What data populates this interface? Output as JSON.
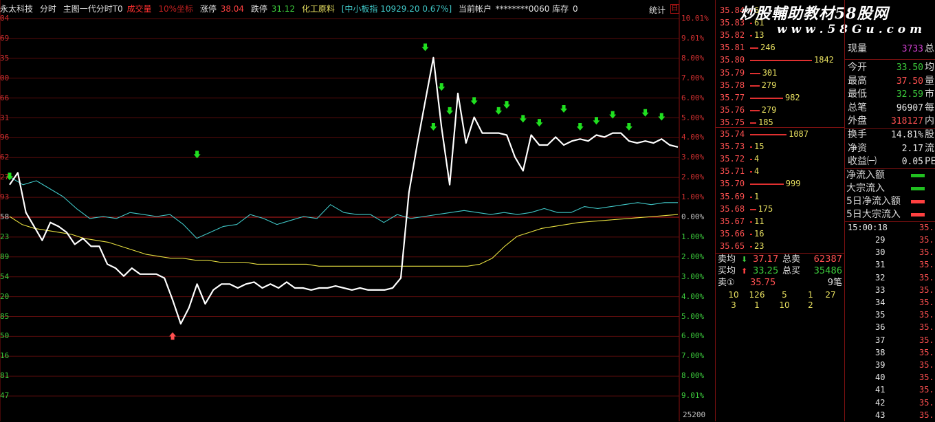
{
  "topbar": {
    "stock_name": "永太科技",
    "chart_mode": "分时",
    "indicator": "主图一代分时T0",
    "volume_label": "成交量",
    "sector_label": "10%坐标",
    "limit_up_label": "涨停",
    "limit_up_value": "38.04",
    "limit_down_label": "跌停",
    "limit_down_value": "31.12",
    "industry": "化工原料",
    "index_text": "[中小板指 10929.20 0.67%]",
    "account_label": "当前帐户",
    "account_value": "********0060",
    "inventory_label": "库存",
    "inventory_value": "0",
    "stats_button": "统计",
    "stats_box": "日"
  },
  "watermark": {
    "title": "炒股輔助教材58股网",
    "url": "w w w . 5 8 G u . c o m"
  },
  "left_axis": [
    "04",
    "69",
    "35",
    "00",
    "66",
    "31",
    "96",
    "62",
    "27",
    "93",
    "58",
    "23",
    "89",
    "54",
    "20",
    "85",
    "50",
    "16",
    "81",
    "47"
  ],
  "right_axis": [
    "10.01%",
    "9.01%",
    "8.00%",
    "7.00%",
    "6.00%",
    "5.00%",
    "4.00%",
    "3.00%",
    "2.00%",
    "1.00%",
    "0.00%",
    "1.00%",
    "2.00%",
    "3.00%",
    "4.00%",
    "5.00%",
    "6.00%",
    "7.00%",
    "8.00%",
    "9.01%"
  ],
  "volume_axis_label": "25200",
  "chart_data": {
    "type": "line",
    "title": "",
    "series": [
      {
        "name": "price",
        "color": "#ffffff",
        "values": [
          1.6,
          2.2,
          0.2,
          -0.5,
          -1.2,
          -0.3,
          -0.5,
          -0.8,
          -1.4,
          -1.1,
          -1.5,
          -1.5,
          -2.4,
          -2.6,
          -3.0,
          -2.6,
          -2.9,
          -2.9,
          -2.9,
          -3.1,
          -4.2,
          -5.4,
          -4.6,
          -3.4,
          -4.4,
          -3.7,
          -3.4,
          -3.4,
          -3.6,
          -3.4,
          -3.3,
          -3.6,
          -3.4,
          -3.6,
          -3.3,
          -3.6,
          -3.6,
          -3.7,
          -3.6,
          -3.6,
          -3.5,
          -3.6,
          -3.7,
          -3.6,
          -3.7,
          -3.7,
          -3.7,
          -3.6,
          -3.1,
          1.2,
          3.6,
          5.8,
          8.0,
          4.5,
          1.6,
          6.2,
          3.7,
          5.0,
          4.2,
          4.2,
          4.2,
          4.1,
          3.0,
          2.3,
          4.1,
          3.6,
          3.6,
          4.0,
          3.6,
          3.8,
          3.9,
          3.8,
          4.1,
          4.0,
          4.2,
          4.2,
          3.8,
          3.7,
          3.8,
          3.7,
          3.9,
          3.6,
          3.5
        ]
      },
      {
        "name": "average",
        "color": "#e8e040",
        "values": [
          0.0,
          -0.4,
          -0.6,
          -0.7,
          -0.8,
          -0.9,
          -1.1,
          -1.2,
          -1.3,
          -1.5,
          -1.7,
          -1.9,
          -2.0,
          -2.1,
          -2.1,
          -2.2,
          -2.2,
          -2.3,
          -2.3,
          -2.3,
          -2.4,
          -2.4,
          -2.4,
          -2.4,
          -2.4,
          -2.5,
          -2.5,
          -2.5,
          -2.5,
          -2.5,
          -2.5,
          -2.5,
          -2.5,
          -2.5,
          -2.5,
          -2.5,
          -2.5,
          -2.5,
          -2.4,
          -2.1,
          -1.5,
          -1.0,
          -0.8,
          -0.6,
          -0.5,
          -0.4,
          -0.3,
          -0.25,
          -0.2,
          -0.15,
          -0.1,
          -0.05,
          0.0,
          0.05,
          0.1
        ]
      },
      {
        "name": "index",
        "color": "#40c8c8",
        "values": [
          2.0,
          1.6,
          1.8,
          1.4,
          1.0,
          0.4,
          -0.1,
          0.0,
          -0.1,
          0.2,
          0.1,
          0.0,
          0.1,
          -0.4,
          -1.1,
          -0.8,
          -0.5,
          -0.4,
          0.1,
          -0.1,
          -0.4,
          -0.2,
          0.0,
          -0.1,
          0.6,
          0.2,
          0.1,
          0.1,
          -0.3,
          0.1,
          -0.1,
          0.0,
          0.1,
          0.2,
          0.3,
          0.2,
          0.1,
          0.2,
          0.1,
          0.2,
          0.4,
          0.2,
          0.2,
          0.5,
          0.4,
          0.5,
          0.6,
          0.7,
          0.6,
          0.7,
          0.7
        ]
      }
    ],
    "ylim": [
      -10.01,
      10.01
    ],
    "sell_markers": [
      [
        0,
        2.0
      ],
      [
        23,
        3.1
      ],
      [
        51,
        8.5
      ],
      [
        52,
        4.5
      ],
      [
        53,
        6.5
      ],
      [
        54,
        5.3
      ],
      [
        57,
        5.8
      ],
      [
        60,
        5.3
      ],
      [
        61,
        5.6
      ],
      [
        63,
        4.9
      ],
      [
        65,
        4.7
      ],
      [
        68,
        5.4
      ],
      [
        70,
        4.5
      ],
      [
        72,
        4.8
      ],
      [
        74,
        5.1
      ],
      [
        76,
        4.5
      ],
      [
        78,
        5.2
      ],
      [
        80,
        5.0
      ]
    ],
    "buy_markers": [
      [
        20,
        -6.0
      ]
    ],
    "grid": true
  },
  "orderbook": {
    "asks": [
      {
        "price": "35.84",
        "vol": "6"
      },
      {
        "price": "35.83",
        "vol": "61"
      },
      {
        "price": "35.82",
        "vol": "13"
      },
      {
        "price": "35.81",
        "vol": "246"
      },
      {
        "price": "35.80",
        "vol": "1842"
      },
      {
        "price": "35.79",
        "vol": "301"
      },
      {
        "price": "35.78",
        "vol": "279"
      },
      {
        "price": "35.77",
        "vol": "982"
      },
      {
        "price": "35.76",
        "vol": "279"
      },
      {
        "price": "35.75",
        "vol": "185"
      }
    ],
    "bids": [
      {
        "price": "35.74",
        "vol": "1087"
      },
      {
        "price": "35.73",
        "vol": "15"
      },
      {
        "price": "35.72",
        "vol": "4"
      },
      {
        "price": "35.71",
        "vol": "4"
      },
      {
        "price": "35.70",
        "vol": "999"
      },
      {
        "price": "35.69",
        "vol": "1"
      },
      {
        "price": "35.68",
        "vol": "175"
      },
      {
        "price": "35.67",
        "vol": "11"
      },
      {
        "price": "35.66",
        "vol": "16"
      },
      {
        "price": "35.65",
        "vol": "23"
      }
    ],
    "sell_avg_label": "卖均",
    "sell_avg": "37.17",
    "total_sell_label": "总卖",
    "total_sell": "62387",
    "buy_avg_label": "买均",
    "buy_avg": "33.25",
    "total_buy_label": "总买",
    "total_buy": "35486",
    "sell1_label": "卖①",
    "sell1_price": "35.75",
    "sell1_count": "9笔",
    "queue_row1": [
      "10",
      "126",
      "5",
      "1",
      "27"
    ],
    "queue_row2": [
      "3",
      "1",
      "10",
      "2"
    ]
  },
  "rightpanel": {
    "current_vol_label": "现量",
    "current_vol": "3733",
    "current_vol_tail": "总",
    "rows": [
      {
        "k": "今开",
        "v": "33.50",
        "t": "均",
        "color": "#3ccc3c"
      },
      {
        "k": "最高",
        "v": "37.50",
        "t": "量",
        "color": "#ff5050"
      },
      {
        "k": "最低",
        "v": "32.59",
        "t": "市",
        "color": "#3ccc3c"
      },
      {
        "k": "总笔",
        "v": "96907",
        "t": "每",
        "color": "#e8e8e8"
      },
      {
        "k": "外盘",
        "v": "318127",
        "t": "内",
        "color": "#ff5050"
      }
    ],
    "rows2": [
      {
        "k": "换手",
        "v": "14.81%",
        "t": "股",
        "color": "#e8e8e8"
      },
      {
        "k": "净资",
        "v": "2.17",
        "t": "流",
        "color": "#e8e8e8"
      },
      {
        "k": "收益㈠",
        "v": "0.05",
        "t": "PE",
        "color": "#e8e8e8"
      }
    ],
    "flows": [
      {
        "k": "净流入额",
        "color": "#20c020"
      },
      {
        "k": "大宗流入",
        "color": "#20c020"
      },
      {
        "k": "5日净流入额",
        "color": "#ff4040"
      },
      {
        "k": "5日大宗流入",
        "color": "#ff4040"
      }
    ],
    "ticks_time": "15:00:18",
    "ticks_price_prefix": "35.",
    "ticks": [
      "29",
      "30",
      "31",
      "32",
      "33",
      "34",
      "35",
      "36",
      "37",
      "38",
      "39",
      "40",
      "41",
      "42",
      "43"
    ]
  }
}
